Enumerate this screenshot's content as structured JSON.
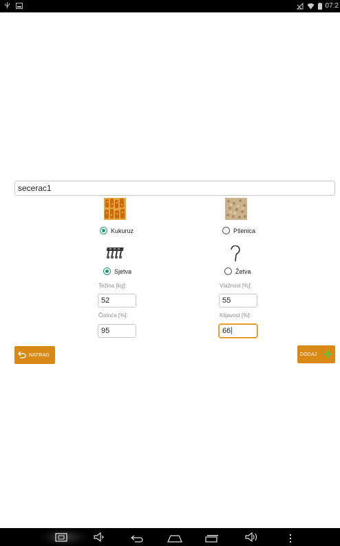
{
  "status_bar": {
    "time": "07:2",
    "left_icons": [
      "usb-icon",
      "image-icon"
    ],
    "right_icons": [
      "signal-off-icon",
      "wifi-icon",
      "battery-icon"
    ]
  },
  "form": {
    "name_value": "secerac1"
  },
  "crop_options": [
    {
      "label": "Kukuruz",
      "selected": true,
      "icon": "corn-icon"
    },
    {
      "label": "Pšenica",
      "selected": false,
      "icon": "wheat-icon"
    }
  ],
  "operation_options": [
    {
      "label": "Sjetva",
      "selected": true,
      "icon": "seeder-icon"
    },
    {
      "label": "Žetva",
      "selected": false,
      "icon": "sickle-icon"
    }
  ],
  "fields": {
    "tezina": {
      "label": "Težina [kg]:",
      "value": "52"
    },
    "vlaznost": {
      "label": "Vlažnost [%]:",
      "value": "55"
    },
    "cistoca": {
      "label": "Čistoća [%]:",
      "value": "95"
    },
    "klijavost": {
      "label": "Klijavost [%]:",
      "value": "66"
    }
  },
  "buttons": {
    "back_label": "NATRAG",
    "add_label": "DODAJ"
  },
  "colors": {
    "accent": "#d98a16",
    "radio_selected": "#1a9a7a",
    "add_icon": "#6bbf3a"
  },
  "nav_bar": {
    "icons": [
      "screenshot-icon",
      "volume-down-icon",
      "back-icon",
      "home-icon",
      "recents-icon",
      "volume-up-icon",
      "menu-icon"
    ]
  }
}
